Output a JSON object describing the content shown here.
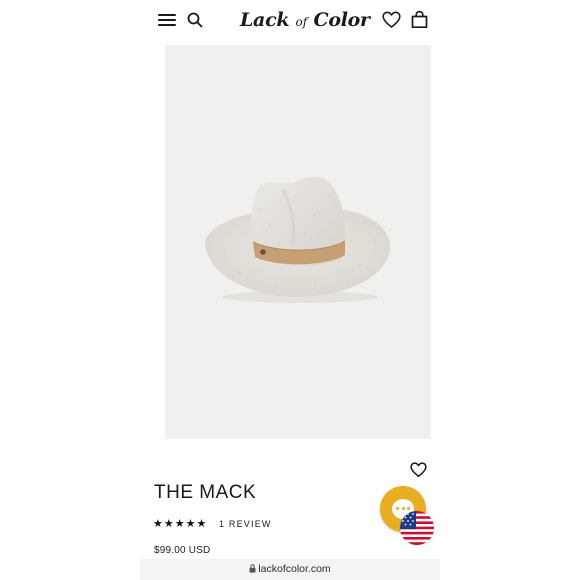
{
  "header": {
    "logo_main_a": "Lack",
    "logo_small": "of",
    "logo_main_b": "Color",
    "icons": [
      "menu-icon",
      "search-icon",
      "heart-icon",
      "bag-icon"
    ]
  },
  "product": {
    "title": "THE MACK",
    "rating_stars": "★★★★★",
    "rating": 5,
    "review_count": "1 REVIEW",
    "price": "$99.00 USD"
  },
  "browser": {
    "url": "lackofcolor.com"
  },
  "colors": {
    "accent_chat": "#e8ad22",
    "image_background": "#f1f0ee",
    "text": "#1a1a1a"
  }
}
